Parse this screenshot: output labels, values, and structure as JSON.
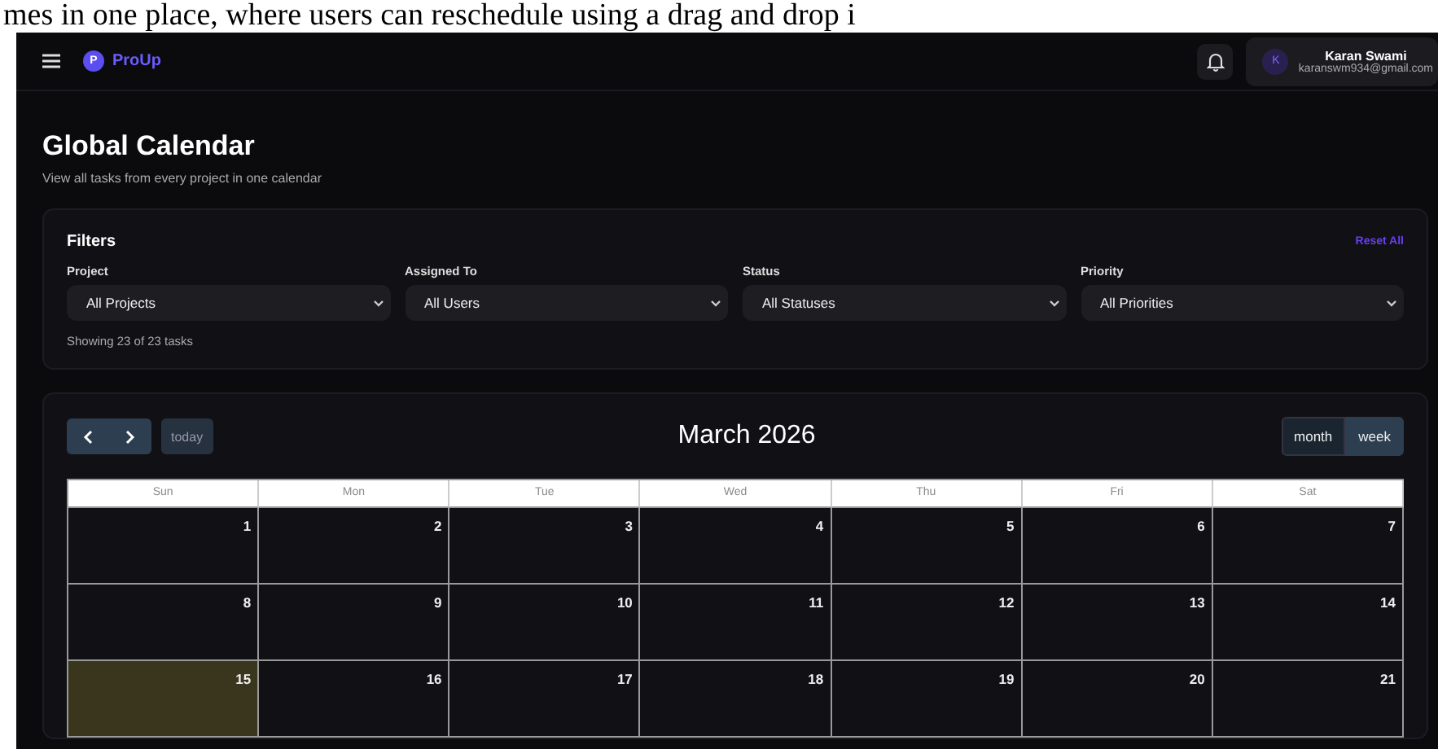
{
  "caption": "mes in one place, where users can reschedule using a drag and drop i",
  "header": {
    "app_name": "ProUp",
    "logo_letter": "P",
    "user": {
      "initial": "K",
      "name": "Karan Swami",
      "email": "karanswm934@gmail.com"
    }
  },
  "page": {
    "title": "Global Calendar",
    "subtitle": "View all tasks from every project in one calendar"
  },
  "filters": {
    "title": "Filters",
    "reset": "Reset All",
    "summary": "Showing 23 of 23 tasks",
    "fields": [
      {
        "label": "Project",
        "value": "All Projects"
      },
      {
        "label": "Assigned To",
        "value": "All Users"
      },
      {
        "label": "Status",
        "value": "All Statuses"
      },
      {
        "label": "Priority",
        "value": "All Priorities"
      }
    ]
  },
  "calendar": {
    "today_button": "today",
    "title": "March 2026",
    "views": [
      {
        "label": "month",
        "selected": true
      },
      {
        "label": "week",
        "selected": false
      }
    ],
    "weekdays": [
      "Sun",
      "Mon",
      "Tue",
      "Wed",
      "Thu",
      "Fri",
      "Sat"
    ],
    "weeks": [
      [
        {
          "day": "1",
          "today": false
        },
        {
          "day": "2",
          "today": false
        },
        {
          "day": "3",
          "today": false
        },
        {
          "day": "4",
          "today": false
        },
        {
          "day": "5",
          "today": false
        },
        {
          "day": "6",
          "today": false
        },
        {
          "day": "7",
          "today": false
        }
      ],
      [
        {
          "day": "8",
          "today": false
        },
        {
          "day": "9",
          "today": false
        },
        {
          "day": "10",
          "today": false
        },
        {
          "day": "11",
          "today": false
        },
        {
          "day": "12",
          "today": false
        },
        {
          "day": "13",
          "today": false
        },
        {
          "day": "14",
          "today": false
        }
      ],
      [
        {
          "day": "15",
          "today": true
        },
        {
          "day": "16",
          "today": false
        },
        {
          "day": "17",
          "today": false
        },
        {
          "day": "18",
          "today": false
        },
        {
          "day": "19",
          "today": false
        },
        {
          "day": "20",
          "today": false
        },
        {
          "day": "21",
          "today": false
        }
      ]
    ]
  }
}
